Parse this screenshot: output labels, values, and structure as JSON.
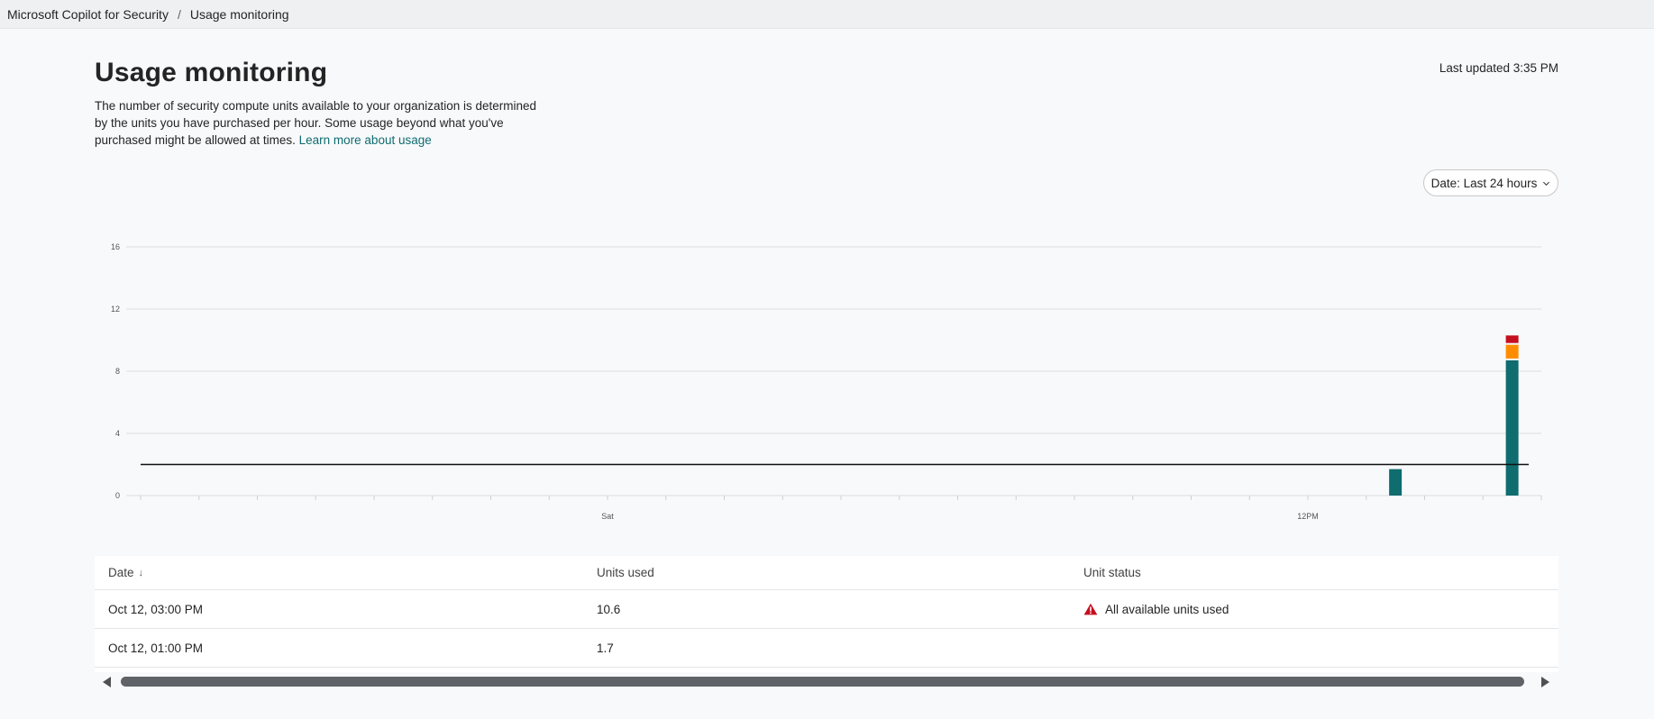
{
  "breadcrumb": {
    "items": [
      "Microsoft Copilot for Security",
      "Usage monitoring"
    ],
    "separator": "/"
  },
  "header": {
    "title": "Usage monitoring",
    "description": "The number of security compute units available to your organization is determined by the units you have purchased per hour. Some usage beyond what you've purchased might be allowed at times.",
    "learn_more": "Learn more about usage",
    "last_updated": "Last updated 3:35 PM"
  },
  "filter": {
    "date_label": "Date: Last 24 hours"
  },
  "chart_data": {
    "type": "bar",
    "title": "",
    "xlabel": "",
    "ylabel": "",
    "ylim": [
      0,
      16
    ],
    "y_ticks": [
      0,
      4,
      8,
      12,
      16
    ],
    "x_tick_labels": [
      {
        "hour_index": 8,
        "label": "Sat"
      },
      {
        "hour_index": 20,
        "label": "12PM"
      }
    ],
    "hours": 24,
    "grid": true,
    "purchased_units_line": 2,
    "bars": [
      {
        "hour_index": 21,
        "time": "Oct 12, 01:00 PM",
        "segments": [
          {
            "value": 1.7,
            "color": "#0f6c6f"
          }
        ]
      },
      {
        "hour_index": 23,
        "time": "Oct 12, 03:00 PM",
        "segments": [
          {
            "value": 8.7,
            "color": "#0f6c6f"
          },
          {
            "value": 1.0,
            "color": "#ff8c00"
          },
          {
            "value": 0.6,
            "color": "#c50f1f"
          }
        ]
      }
    ],
    "colors": {
      "within_limit": "#0f6c6f",
      "beyond_limit": "#ff8c00",
      "exceeded": "#c50f1f",
      "limit_line": "#111111"
    }
  },
  "table": {
    "columns": [
      "Date",
      "Units used",
      "Unit status"
    ],
    "sort_indicator": "↓",
    "rows": [
      {
        "date": "Oct 12, 03:00 PM",
        "units": "10.6",
        "status": "All available units used",
        "status_icon": "warning-icon"
      },
      {
        "date": "Oct 12, 01:00 PM",
        "units": "1.7",
        "status": "",
        "status_icon": ""
      }
    ]
  },
  "colors": {
    "accent": "#0f6c6f",
    "warning": "#c50f1f"
  }
}
